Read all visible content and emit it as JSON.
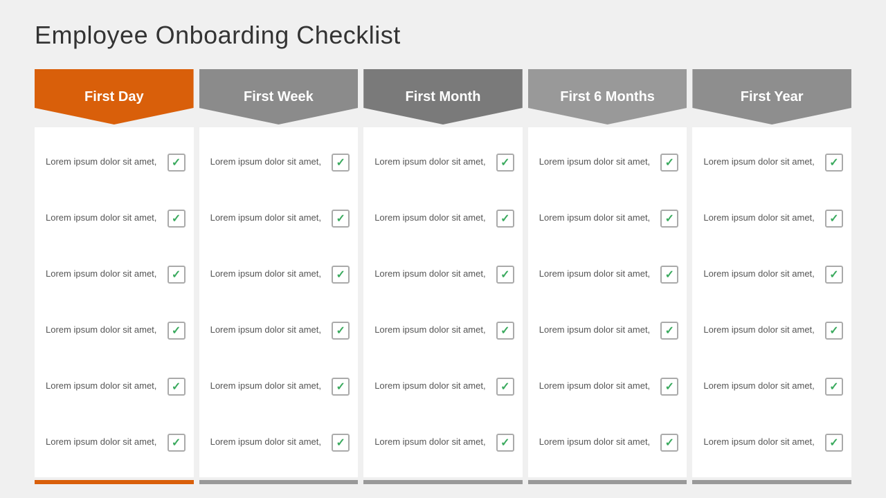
{
  "title": "Employee  Onboarding Checklist",
  "columns": [
    {
      "id": "first-day",
      "label": "First Day",
      "colorClass": "orange",
      "footerClass": "orange",
      "items": [
        "Lorem ipsum\ndolor sit amet,",
        "Lorem ipsum\ndolor sit amet,",
        "Lorem ipsum\ndolor sit amet,",
        "Lorem ipsum\ndolor sit amet,",
        "Lorem ipsum\ndolor sit amet,",
        "Lorem ipsum\ndolor sit amet,"
      ]
    },
    {
      "id": "first-week",
      "label": "First Week",
      "colorClass": "gray1",
      "footerClass": "gray",
      "items": [
        "Lorem ipsum\ndolor sit amet,",
        "Lorem ipsum\ndolor sit amet,",
        "Lorem ipsum\ndolor sit amet,",
        "Lorem ipsum\ndolor sit amet,",
        "Lorem ipsum\ndolor sit amet,",
        "Lorem ipsum\ndolor sit amet,"
      ]
    },
    {
      "id": "first-month",
      "label": "First Month",
      "colorClass": "gray2",
      "footerClass": "gray",
      "items": [
        "Lorem ipsum\ndolor sit amet,",
        "Lorem ipsum\ndolor sit amet,",
        "Lorem ipsum\ndolor sit amet,",
        "Lorem ipsum\ndolor sit amet,",
        "Lorem ipsum\ndolor sit amet,",
        "Lorem ipsum\ndolor sit amet,"
      ]
    },
    {
      "id": "first-6-months",
      "label": "First 6 Months",
      "colorClass": "gray3",
      "footerClass": "gray",
      "items": [
        "Lorem ipsum\ndolor sit amet,",
        "Lorem ipsum\ndolor sit amet,",
        "Lorem ipsum\ndolor sit amet,",
        "Lorem ipsum\ndolor sit amet,",
        "Lorem ipsum\ndolor sit amet,",
        "Lorem ipsum\ndolor sit amet,"
      ]
    },
    {
      "id": "first-year",
      "label": "First Year",
      "colorClass": "gray4",
      "footerClass": "gray",
      "items": [
        "Lorem ipsum\ndolor sit amet,",
        "Lorem ipsum\ndolor sit amet,",
        "Lorem ipsum\ndolor sit amet,",
        "Lorem ipsum\ndolor sit amet,",
        "Lorem ipsum\ndolor sit amet,",
        "Lorem ipsum\ndolor sit amet,"
      ]
    }
  ]
}
